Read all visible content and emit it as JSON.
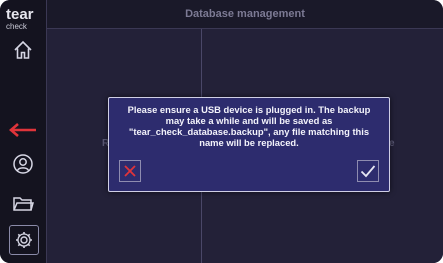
{
  "logo": {
    "line1": "tear",
    "line2": "check"
  },
  "header": {
    "title": "Database management"
  },
  "sidebar": {
    "items": [
      {
        "icon": "home-icon"
      },
      {
        "icon": "back-arrow-icon",
        "color": "#e0343a"
      },
      {
        "icon": "user-icon"
      },
      {
        "icon": "folder-icon"
      },
      {
        "icon": "gear-icon"
      }
    ]
  },
  "background": {
    "left_partial": "R",
    "right_partial": "e"
  },
  "dialog": {
    "message": "Please ensure a USB device is plugged in. The backup may take a while and will be saved as \"tear_check_database.backup\", any file matching this name will be replaced.",
    "cancel_icon": "close-icon",
    "cancel_color": "#e0343a",
    "confirm_icon": "check-icon"
  }
}
